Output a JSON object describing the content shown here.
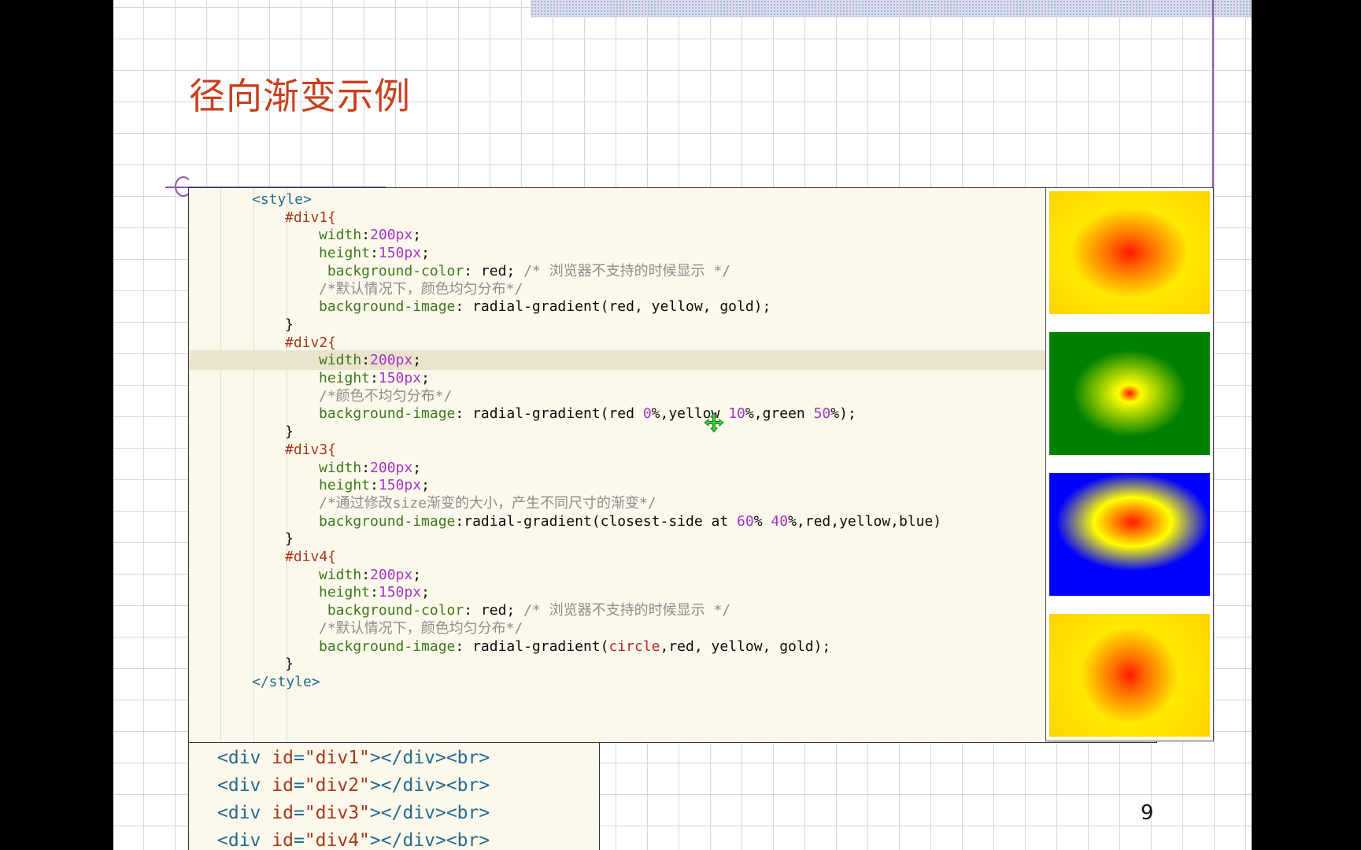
{
  "slide": {
    "title": "径向渐变示例",
    "page_number": "9"
  },
  "css_lines": [
    [
      {
        "t": "<style>",
        "c": "tag"
      }
    ],
    [
      {
        "t": "#div1{",
        "c": "sel"
      }
    ],
    [
      {
        "t": "width",
        "c": "prop"
      },
      {
        "t": ":",
        "c": "p"
      },
      {
        "t": "200px",
        "c": "num"
      },
      {
        "t": ";",
        "c": "p"
      }
    ],
    [
      {
        "t": "height",
        "c": "prop"
      },
      {
        "t": ":",
        "c": "p"
      },
      {
        "t": "150px",
        "c": "num"
      },
      {
        "t": ";",
        "c": "p"
      }
    ],
    [
      {
        "t": " background-color",
        "c": "prop"
      },
      {
        "t": ": red; ",
        "c": "p"
      },
      {
        "t": "/* 浏览器不支持的时候显示 */",
        "c": "cm"
      }
    ],
    [
      {
        "t": "/*默认情况下，颜色均匀分布*/",
        "c": "cm"
      }
    ],
    [
      {
        "t": "background-image",
        "c": "prop"
      },
      {
        "t": ": radial-gradient(red, yellow, gold);",
        "c": "p"
      }
    ],
    [
      {
        "t": "}",
        "c": "p"
      }
    ],
    [
      {
        "t": "#div2{",
        "c": "sel"
      }
    ],
    [
      {
        "t": "width",
        "c": "prop"
      },
      {
        "t": ":",
        "c": "p"
      },
      {
        "t": "200px",
        "c": "num"
      },
      {
        "t": ";",
        "c": "p"
      }
    ],
    [
      {
        "t": "height",
        "c": "prop"
      },
      {
        "t": ":",
        "c": "p"
      },
      {
        "t": "150px",
        "c": "num"
      },
      {
        "t": ";",
        "c": "p"
      }
    ],
    [
      {
        "t": "/*颜色不均匀分布*/",
        "c": "cm"
      }
    ],
    [
      {
        "t": "background-image",
        "c": "prop"
      },
      {
        "t": ": radial-gradient(red ",
        "c": "p"
      },
      {
        "t": "0",
        "c": "num"
      },
      {
        "t": "%,yellow ",
        "c": "p"
      },
      {
        "t": "10",
        "c": "num"
      },
      {
        "t": "%,green ",
        "c": "p"
      },
      {
        "t": "50",
        "c": "num"
      },
      {
        "t": "%);",
        "c": "p"
      }
    ],
    [
      {
        "t": "}",
        "c": "p"
      }
    ],
    [
      {
        "t": "#div3{",
        "c": "sel"
      }
    ],
    [
      {
        "t": "width",
        "c": "prop"
      },
      {
        "t": ":",
        "c": "p"
      },
      {
        "t": "200px",
        "c": "num"
      },
      {
        "t": ";",
        "c": "p"
      }
    ],
    [
      {
        "t": "height",
        "c": "prop"
      },
      {
        "t": ":",
        "c": "p"
      },
      {
        "t": "150px",
        "c": "num"
      },
      {
        "t": ";",
        "c": "p"
      }
    ],
    [
      {
        "t": "/*通过修改size渐变的大小，产生不同尺寸的渐变*/",
        "c": "cm"
      }
    ],
    [
      {
        "t": "background-image",
        "c": "prop"
      },
      {
        "t": ":radial-gradient(closest-side at ",
        "c": "p"
      },
      {
        "t": "60",
        "c": "num"
      },
      {
        "t": "% ",
        "c": "p"
      },
      {
        "t": "40",
        "c": "num"
      },
      {
        "t": "%,red,yellow,blue)",
        "c": "p"
      }
    ],
    [
      {
        "t": "}",
        "c": "p"
      }
    ],
    [
      {
        "t": "#div4{",
        "c": "sel"
      }
    ],
    [
      {
        "t": "width",
        "c": "prop"
      },
      {
        "t": ":",
        "c": "p"
      },
      {
        "t": "200px",
        "c": "num"
      },
      {
        "t": ";",
        "c": "p"
      }
    ],
    [
      {
        "t": "height",
        "c": "prop"
      },
      {
        "t": ":",
        "c": "p"
      },
      {
        "t": "150px",
        "c": "num"
      },
      {
        "t": ";",
        "c": "p"
      }
    ],
    [
      {
        "t": " background-color",
        "c": "prop"
      },
      {
        "t": ": red; ",
        "c": "p"
      },
      {
        "t": "/* 浏览器不支持的时候显示 */",
        "c": "cm"
      }
    ],
    [
      {
        "t": "/*默认情况下，颜色均匀分布*/",
        "c": "cm"
      }
    ],
    [
      {
        "t": "background-image",
        "c": "prop"
      },
      {
        "t": ": radial-gradient(",
        "c": "p"
      },
      {
        "t": "circle",
        "c": "kw"
      },
      {
        "t": ",red, yellow, gold);",
        "c": "p"
      }
    ],
    [
      {
        "t": "}",
        "c": "p"
      }
    ],
    [
      {
        "t": "</style>",
        "c": "tag"
      }
    ]
  ],
  "html_lines": [
    [
      {
        "t": "<div ",
        "c": "tag"
      },
      {
        "t": "id",
        "c": "attr"
      },
      {
        "t": "=",
        "c": "tag"
      },
      {
        "t": "\"div1\"",
        "c": "str"
      },
      {
        "t": "></div><br>",
        "c": "tag"
      }
    ],
    [
      {
        "t": "<div ",
        "c": "tag"
      },
      {
        "t": "id",
        "c": "attr"
      },
      {
        "t": "=",
        "c": "tag"
      },
      {
        "t": "\"div2\"",
        "c": "str"
      },
      {
        "t": "></div><br>",
        "c": "tag"
      }
    ],
    [
      {
        "t": "<div ",
        "c": "tag"
      },
      {
        "t": "id",
        "c": "attr"
      },
      {
        "t": "=",
        "c": "tag"
      },
      {
        "t": "\"div3\"",
        "c": "str"
      },
      {
        "t": "></div><br>",
        "c": "tag"
      }
    ],
    [
      {
        "t": "<div ",
        "c": "tag"
      },
      {
        "t": "id",
        "c": "attr"
      },
      {
        "t": "=",
        "c": "tag"
      },
      {
        "t": "\"div4\"",
        "c": "str"
      },
      {
        "t": "></div><br>",
        "c": "tag"
      }
    ]
  ],
  "highlighted_line": 9,
  "colors": {
    "title": "#c8401e",
    "accent_rule": "#8a5aa8",
    "code_bg": "#fdf8ec",
    "line_highlight": "#ebe4cd"
  },
  "previews": [
    {
      "name": "div1",
      "colors": [
        "#ff1a00",
        "#ffe800",
        "#ffd300"
      ]
    },
    {
      "name": "div2",
      "colors": [
        "#ff1a00",
        "#ffff00",
        "#008000"
      ]
    },
    {
      "name": "div3",
      "colors": [
        "#ff1a00",
        "#ffff00",
        "#0000ff"
      ]
    },
    {
      "name": "div4",
      "colors": [
        "#ff1a00",
        "#ffe800",
        "#ffd300"
      ]
    }
  ],
  "cursor_icon": "move-cursor-icon"
}
